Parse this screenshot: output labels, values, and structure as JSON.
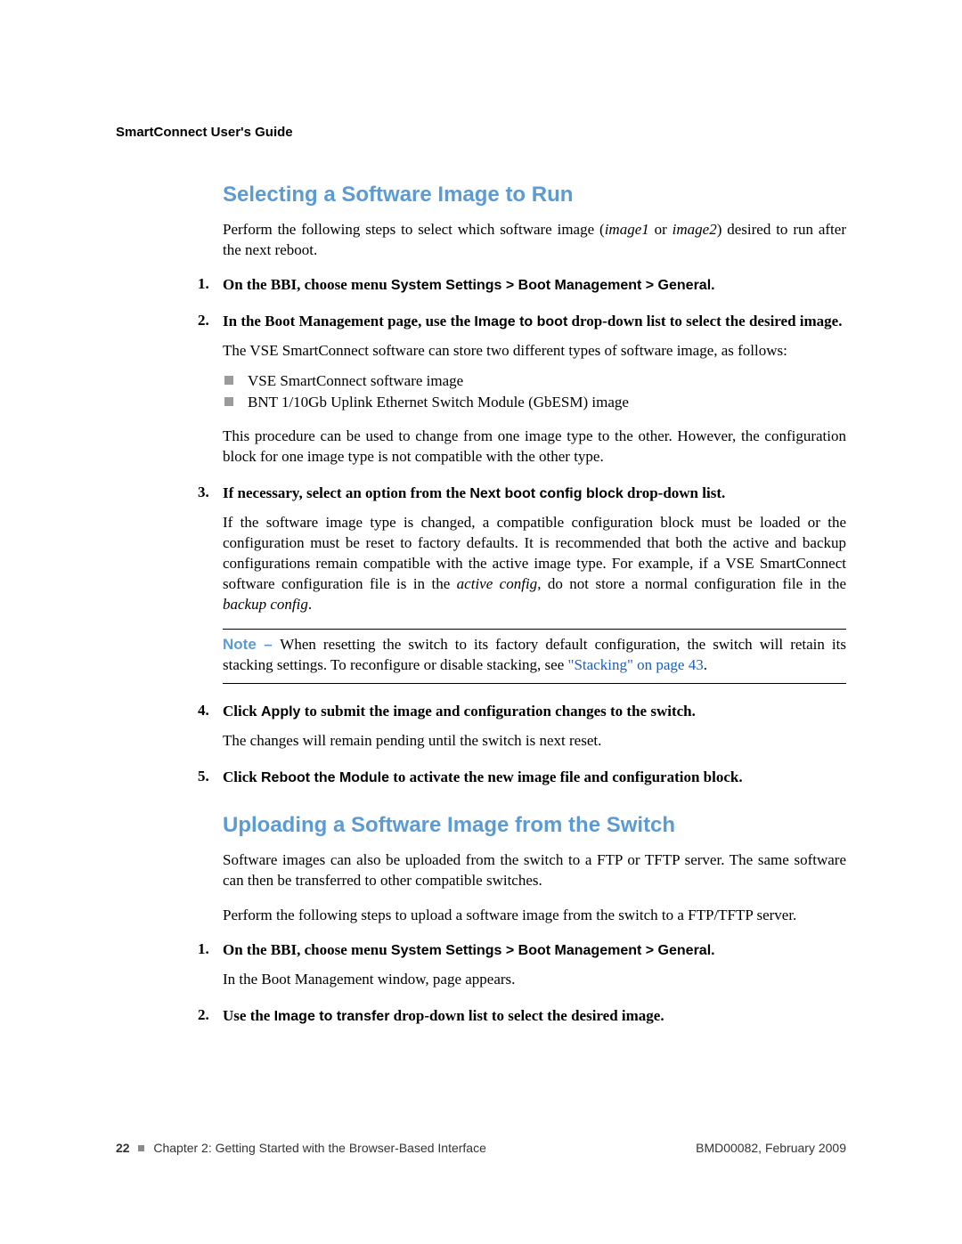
{
  "header": {
    "doc_title": "SmartConnect User's Guide"
  },
  "sections": {
    "s1": {
      "heading": "Selecting a Software Image to Run",
      "intro_pre": "Perform the following steps to select which software image (",
      "intro_i1": "image1",
      "intro_mid": " or ",
      "intro_i2": "image2",
      "intro_post": ") desired to run after the next reboot.",
      "step1": {
        "num": "1.",
        "t1": "On the BBI, choose menu ",
        "sb": "System Settings > Boot Management > General.",
        "t2": ""
      },
      "step2": {
        "num": "2.",
        "t1": "In the Boot Management page, use the ",
        "sb": "Image to boot",
        "t2": " drop-down list to select the desired image."
      },
      "step2_after": "The VSE SmartConnect software can store two different types of software image, as follows:",
      "bullets": {
        "b1": "VSE SmartConnect software image",
        "b2": "BNT 1/10Gb Uplink Ethernet Switch Module (GbESM) image"
      },
      "step2_after2": "This procedure can be used to change from one image type to the other. However, the configuration block for one image type is not compatible with the other type.",
      "step3": {
        "num": "3.",
        "t1": "If necessary, select an option from the ",
        "sb": "Next boot config block",
        "t2": " drop-down list."
      },
      "step3_after_a": "If the software image type is changed, a compatible configuration block must be loaded or the configuration must be reset to factory defaults. It is recommended that both the active and backup configurations remain compatible with the active image type. For example, if a VSE SmartConnect software configuration file is in the ",
      "step3_after_i1": "active config",
      "step3_after_b": ", do not store a normal configuration file in the ",
      "step3_after_i2": "backup config",
      "step3_after_c": ".",
      "note": {
        "label": "Note – ",
        "t1": "When resetting the switch to its factory default configuration, the switch will retain its stacking settings. To reconfigure or disable stacking, see ",
        "xref": "\"Stacking\" on page 43",
        "t2": "."
      },
      "step4": {
        "num": "4.",
        "t1": "Click ",
        "sb": "Apply",
        "t2": " to submit the image and configuration changes to the switch."
      },
      "step4_after": "The changes will remain pending until the switch is next reset.",
      "step5": {
        "num": "5.",
        "t1": "Click ",
        "sb": "Reboot the Module",
        "t2": " to activate the new image file and configuration block."
      }
    },
    "s2": {
      "heading": "Uploading a Software Image from the Switch",
      "intro": "Software images can also be uploaded from the switch to a FTP or TFTP server. The same software can then be transferred to other compatible switches.",
      "intro2": "Perform the following steps to upload a software image from the switch to a FTP/TFTP server.",
      "step1": {
        "num": "1.",
        "t1": "On the BBI, choose menu ",
        "sb": "System Settings > Boot Management > General.",
        "t2": ""
      },
      "step1_after": "In the Boot Management window, page appears.",
      "step2": {
        "num": "2.",
        "t1": "Use the ",
        "sb": "Image to transfer",
        "t2": " drop-down list to select the desired image."
      }
    }
  },
  "footer": {
    "page_num": "22",
    "chapter": "Chapter 2: Getting Started with the Browser-Based Interface",
    "docref": "BMD00082, February 2009"
  }
}
